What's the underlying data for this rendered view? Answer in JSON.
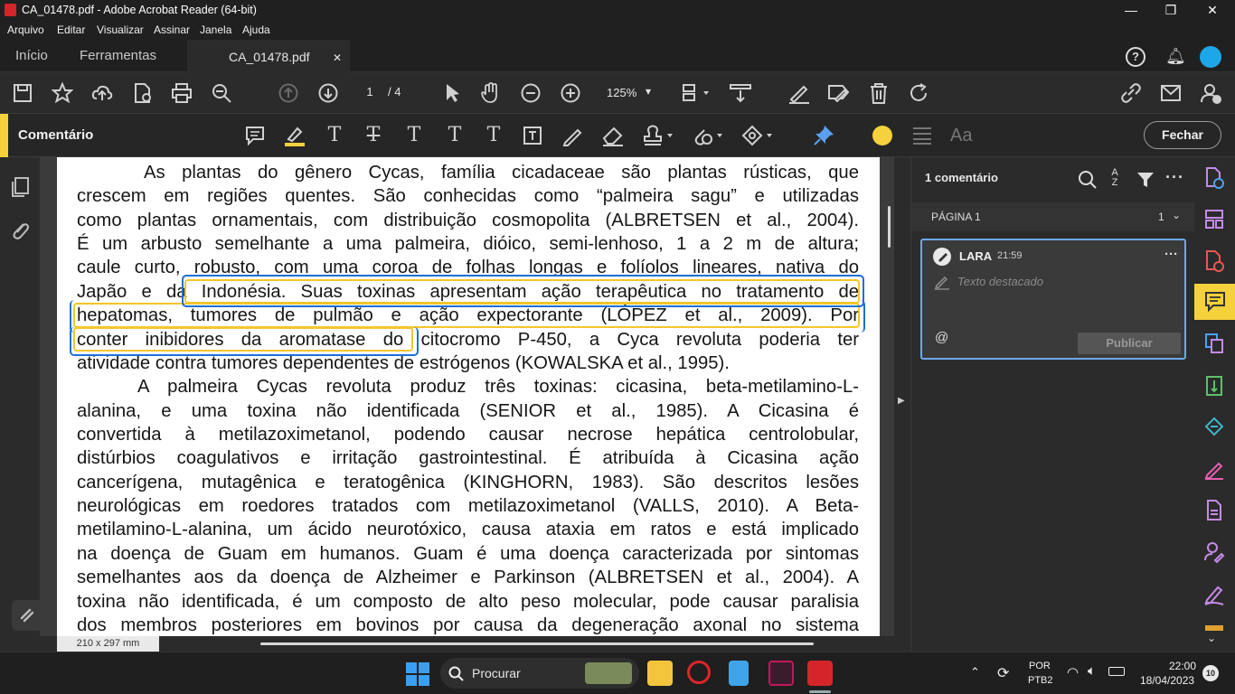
{
  "window": {
    "title": "CA_01478.pdf - Adobe Acrobat Reader (64-bit)",
    "min_glyph": "—",
    "max_glyph": "❐",
    "close_glyph": "✕"
  },
  "menu": [
    "Arquivo",
    "Editar",
    "Visualizar",
    "Assinar",
    "Janela",
    "Ajuda"
  ],
  "tabs": {
    "home": "Início",
    "tools": "Ferramentas",
    "document": "CA_01478.pdf",
    "close_glyph": "✕"
  },
  "toolbar": {
    "page_current": "1",
    "page_total": "/ 4",
    "zoom": "125%",
    "zoom_arrow": "▾"
  },
  "comment_toolbar": {
    "label": "Comentário",
    "close_label": "Fechar",
    "font_label": "Aa"
  },
  "document": {
    "lines": [
      "As plantas do gênero Cycas, família cicadaceae são plantas rústicas, que",
      "crescem em regiões quentes. São conhecidas como “palmeira sagu” e utilizadas",
      "como plantas ornamentais, com distribuição cosmopolita (ALBRETSEN et al., 2004).",
      "É um arbusto semelhante a uma palmeira, dióico, semi-lenhoso, 1 a 2 m de altura;",
      "caule curto, robusto, com uma coroa de folhas longas e folíolos lineares, nativa do",
      "Japão e da Indonésia.  Suas toxinas apresentam ação terapêutica no tratamento de",
      "hepatomas, tumores de pulmão e ação expectorante (LÓPEZ et al., 2009). Por",
      "conter inibidores da aromatase do citocromo P-450, a Cyca revoluta poderia ter",
      "atividade contra tumores dependentes de estrógenos (KOWALSKA et al., 1995).",
      "A palmeira Cycas revoluta produz três toxinas: cicasina, beta-metilamino-L-",
      "alanina, e uma toxina não identificada (SENIOR et al., 1985). A Cicasina é",
      "convertida à metilazoximetanol, podendo causar necrose hepática centrolobular,",
      "distúrbios coagulativos e irritação gastrointestinal. É atribuída à Cicasina ação",
      "cancerígena, mutagênica e teratogênica (KINGHORN, 1983). São descritos lesões",
      "neurológicas em roedores tratados com metilazoximetanol (VALLS, 2010). A Beta-",
      "metilamino-L-alanina, um ácido neurotóxico, causa ataxia em ratos e está implicado",
      "na doença de Guam em humanos. Guam é uma doença caracterizada por sintomas",
      "semelhantes aos da doença de Alzheimer e Parkinson (ALBRETSEN et al., 2004). A",
      "toxina não identificada, é um composto de alto peso molecular, pode causar paralisia",
      "dos membros posteriores em bovinos por causa da degeneração axonal no sistema"
    ],
    "page_size": "210 x 297 mm"
  },
  "comments_panel": {
    "count_label": "1 comentário",
    "page_label": "PÁGINA 1",
    "page_count": "1",
    "comment": {
      "author": "LARA",
      "time": "21:59",
      "placeholder": "Texto destacado",
      "mention": "@",
      "publish_label": "Publicar",
      "more": "···"
    }
  },
  "taskbar": {
    "search_label": "Procurar",
    "lang_top": "POR",
    "lang_bottom": "PTB2",
    "time": "22:00",
    "date": "18/04/2023",
    "notifications": "10"
  },
  "colors": {
    "highlight_yellow": "#f5c52a",
    "selection_blue": "#1d6fd6",
    "comment_accent": "#f5d13b",
    "side_tool_purple": "#c58be8"
  }
}
